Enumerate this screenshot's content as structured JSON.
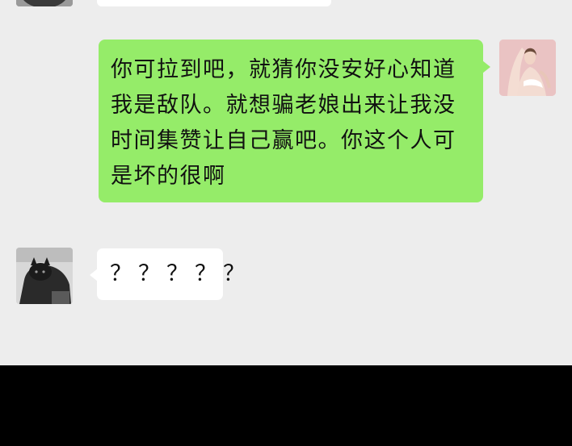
{
  "colors": {
    "background": "#ededed",
    "outgoing_bubble": "#95ec69",
    "incoming_bubble": "#ffffff",
    "bottom_bar": "#000000"
  },
  "messages": [
    {
      "sender": "other",
      "text": ""
    },
    {
      "sender": "me",
      "text": "你可拉到吧，就猜你没安好心知道我是敌队。就想骗老娘出来让我没时间集赞让自己赢吧。你这个人可是坏的很啊"
    },
    {
      "sender": "other",
      "text": "？？？？？"
    }
  ],
  "avatars": {
    "me": "woman-photo-avatar",
    "other": "black-cat-photo-avatar"
  }
}
